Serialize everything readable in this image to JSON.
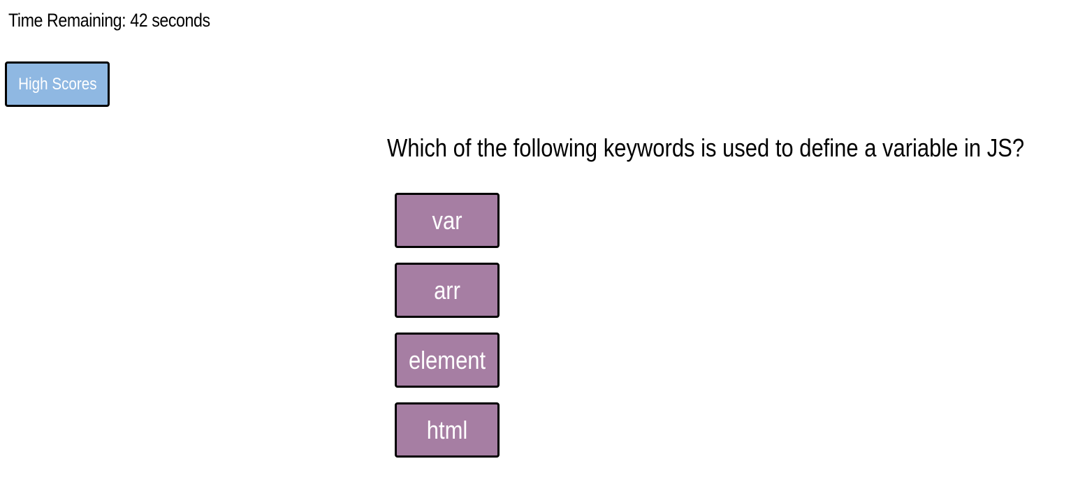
{
  "timer": {
    "label": "Time Remaining: 42 seconds"
  },
  "nav": {
    "high_scores_label": "High Scores"
  },
  "quiz": {
    "question": "Which of the following keywords is used to define a variable in JS?",
    "answers": [
      "var",
      "arr",
      "element",
      "html"
    ]
  },
  "colors": {
    "high_scores_bg": "#8fb8e2",
    "answer_bg": "#a67ea3",
    "border": "#000000"
  }
}
